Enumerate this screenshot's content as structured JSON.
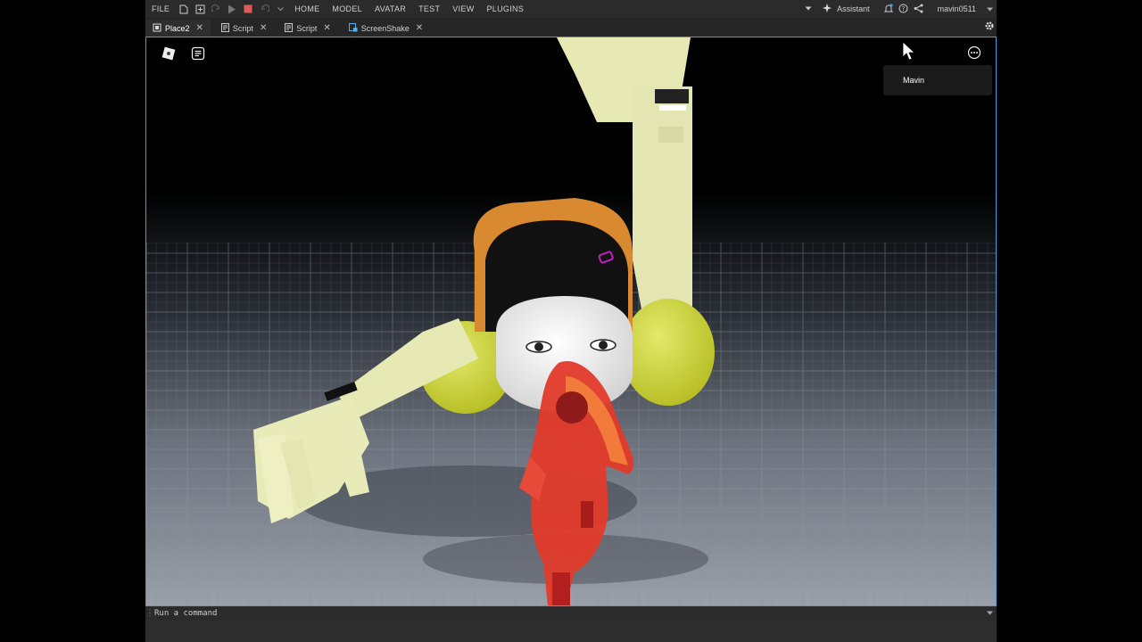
{
  "menu": {
    "file": "FILE",
    "items": [
      "HOME",
      "MODEL",
      "AVATAR",
      "TEST",
      "VIEW",
      "PLUGINS"
    ],
    "assistant": "Assistant",
    "username": "mavin0511"
  },
  "tabs": [
    {
      "label": "Place2",
      "icon": "place-icon",
      "active": true
    },
    {
      "label": "Script",
      "icon": "script-icon",
      "active": false
    },
    {
      "label": "Script",
      "icon": "script-icon",
      "active": false
    },
    {
      "label": "ScreenShake",
      "icon": "module-script-icon",
      "active": false
    }
  ],
  "viewport": {
    "player_name": "Mavin"
  },
  "command": {
    "placeholder": "Run a command"
  },
  "colors": {
    "accent": "#3aa3e3",
    "stop": "#e05a5a",
    "toolbar": "#2b2b2b"
  }
}
